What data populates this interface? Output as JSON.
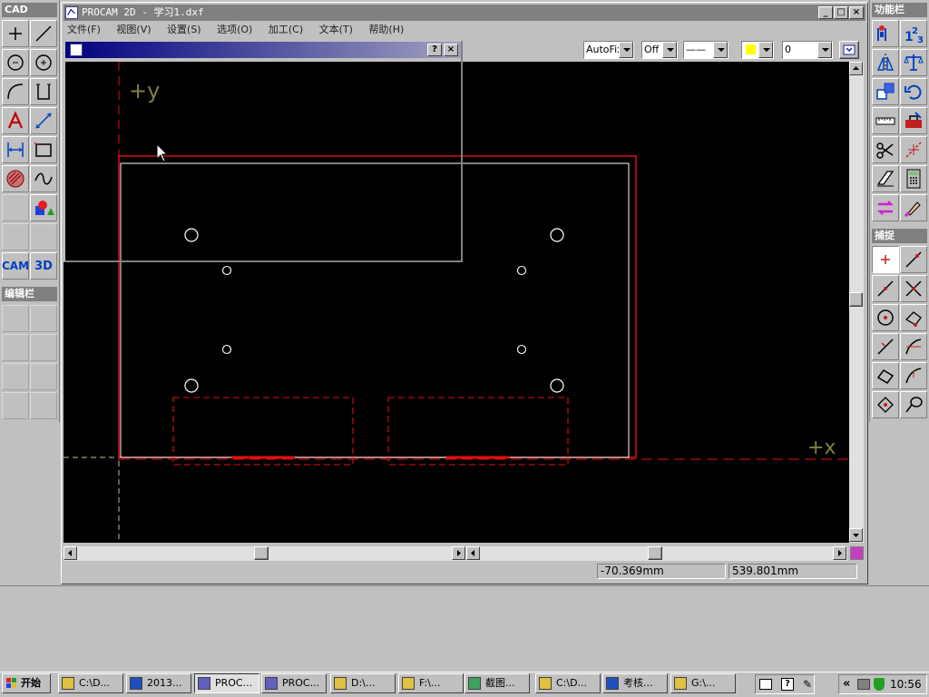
{
  "app": {
    "title": "PROCAM 2D - 学习1.dxf",
    "window_buttons": {
      "min": "_",
      "max": "□",
      "close": "×"
    }
  },
  "menu": [
    "文件(F)",
    "视图(V)",
    "设置(S)",
    "选项(O)",
    "加工(C)",
    "文本(T)",
    "帮助(H)"
  ],
  "toolbar": {
    "autofix": "AutoFix",
    "off": "Off",
    "line_style": "——",
    "layer": "0"
  },
  "subwindow": {
    "help": "?",
    "close": "×"
  },
  "panels": {
    "cad": "CAD",
    "edit": "编辑栏",
    "function": "功能栏",
    "capture": "捕捉"
  },
  "cad_tools": [
    "add-point",
    "line",
    "circle-3pt",
    "circle-center",
    "arc",
    "polyline",
    "text",
    "dimension",
    "measure",
    "rectangle",
    "hatch",
    "curve",
    "empty",
    "solid-3d",
    "empty",
    "empty"
  ],
  "cam_labels": {
    "cam": "CAM",
    "threed": "3D"
  },
  "canvas": {
    "axis_y": "+y",
    "axis_x": "+x"
  },
  "status": {
    "x": "-70.369mm",
    "y": "539.801mm"
  },
  "taskbar": {
    "start": "开始",
    "items": [
      {
        "label": "C:\\D...",
        "icon": "folder"
      },
      {
        "label": "2013...",
        "icon": "word"
      },
      {
        "label": "PROC...",
        "icon": "procam",
        "active": true
      },
      {
        "label": "PROC...",
        "icon": "procam"
      },
      {
        "label": "D:\\...",
        "icon": "folder"
      },
      {
        "label": "F:\\...",
        "icon": "folder"
      },
      {
        "label": "截图...",
        "icon": "image"
      },
      {
        "label": "C:\\D...",
        "icon": "folder"
      },
      {
        "label": "考核...",
        "icon": "word"
      },
      {
        "label": "G:\\...",
        "icon": "folder"
      }
    ],
    "clock": "10:56",
    "tray_arrows": "«"
  },
  "colors": {
    "canvas_bg": "#000000",
    "drawing_red": "#e01010",
    "drawing_white": "#ffffff",
    "axis_label": "#808040",
    "title_bar": "#808080"
  }
}
